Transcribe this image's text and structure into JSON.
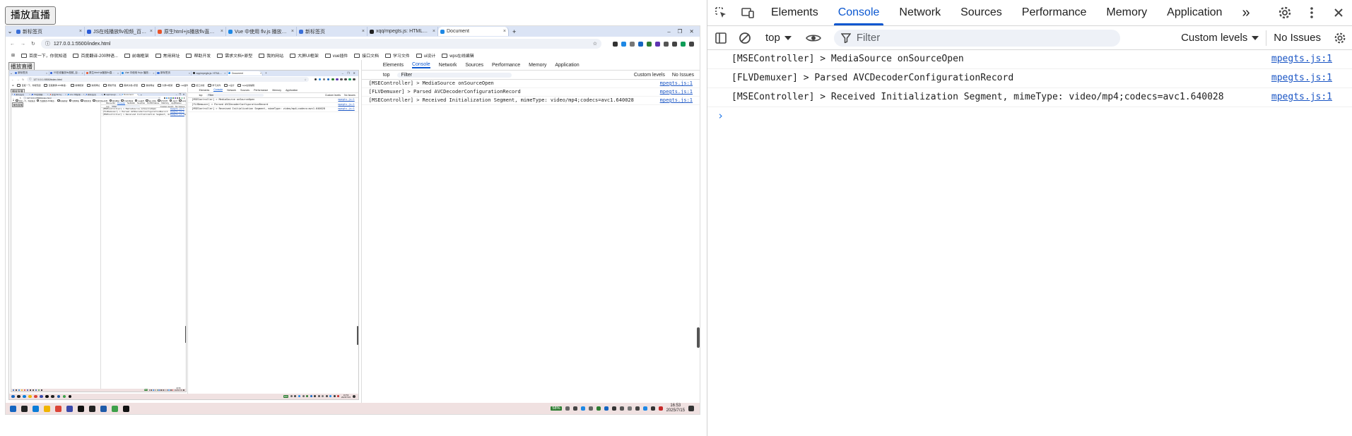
{
  "page": {
    "play_button": "播放直播"
  },
  "browser": {
    "tabs": [
      {
        "label": "新标签页",
        "color": "#3a6fd8"
      },
      {
        "label": "JS在线播放flv视频_百度搜索",
        "color": "#2a5bd7"
      },
      {
        "label": "原生html+js播放flv直播视频",
        "color": "#e8542a"
      },
      {
        "label": "Vue 中使用 flv.js 播放视频 - ...",
        "color": "#1e88e5"
      },
      {
        "label": "新标签页",
        "color": "#3a6fd8"
      },
      {
        "label": "xqq/mpegts.js: HTML5 MPEG...",
        "color": "#222222"
      },
      {
        "label": "Document",
        "color": "#1e88e5",
        "active": true
      }
    ],
    "new_tab": "+",
    "url": "127.0.0.1:5500/index.html",
    "bookmarks": [
      "百度一下，你就知道",
      "百度翻译-200种语...",
      "前端框架",
      "常用网址",
      "帮助开发",
      "需求文档+原型",
      "我的网站",
      "大屏UI框架",
      "vue插件",
      "接口文档",
      "学习文件",
      "ui设计",
      "wps在线编辑"
    ]
  },
  "taskbar": {
    "time": "16:53",
    "date": "2025/7/15",
    "battery": "58%"
  },
  "devtools": {
    "tabs": [
      "Elements",
      "Console",
      "Network",
      "Sources",
      "Performance",
      "Memory",
      "Application"
    ],
    "active_tab": "Console",
    "more": "»",
    "context": "top",
    "filter_placeholder": "Filter",
    "levels": "Custom levels",
    "issues": "No Issues",
    "logs": [
      {
        "text": "[MSEController] > MediaSource onSourceOpen",
        "source": "mpegts.js:1"
      },
      {
        "text": "[FLVDemuxer] > Parsed AVCDecoderConfigurationRecord",
        "source": "mpegts.js:1"
      },
      {
        "text": "[MSEController] > Received Initialization Segment, mimeType: video/mp4;codecs=avc1.640028",
        "source": "mpegts.js:1"
      }
    ],
    "prompt": "›"
  }
}
